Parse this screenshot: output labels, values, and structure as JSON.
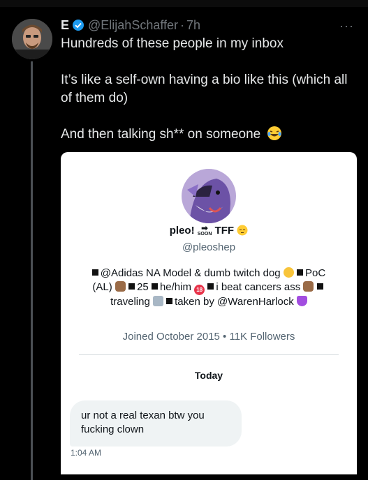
{
  "tweet": {
    "author_name": "E",
    "author_handle": "@ElijahSchaffer",
    "separator": "·",
    "time": "7h",
    "lines": [
      "Hundreds of these people in my inbox",
      "It’s like a self-own having a bio like this (which all of them do)",
      "And then talking sh** on someone"
    ],
    "more": "···"
  },
  "screenshot": {
    "profile_name": "pleo!",
    "profile_name_after": "TFF",
    "soon_label": "SOON",
    "soon_arrow": "➡",
    "handle": "@pleoshep",
    "bio": {
      "b1": "@Adidas NA Model & dumb twitch dog",
      "b2": "PoC (AL)",
      "b3": "25",
      "b4": "he/him",
      "b5": "i beat cancers ass",
      "b6": "traveling",
      "b7": "taken by @WarenHarlock",
      "eighteen": "18"
    },
    "joined": "Joined October 2015 • 11K Followers",
    "day_label": "Today",
    "message": "ur not a real texan btw you fucking clown",
    "message_time": "1:04 AM"
  },
  "colors": {
    "background": "#000000",
    "verified": "#1d9bf0",
    "muted": "#71767b",
    "card": "#ffffff"
  },
  "icons": [
    "verified-badge-icon",
    "more-icon",
    "laughing-emoji-icon",
    "pensive-emoji-icon"
  ]
}
